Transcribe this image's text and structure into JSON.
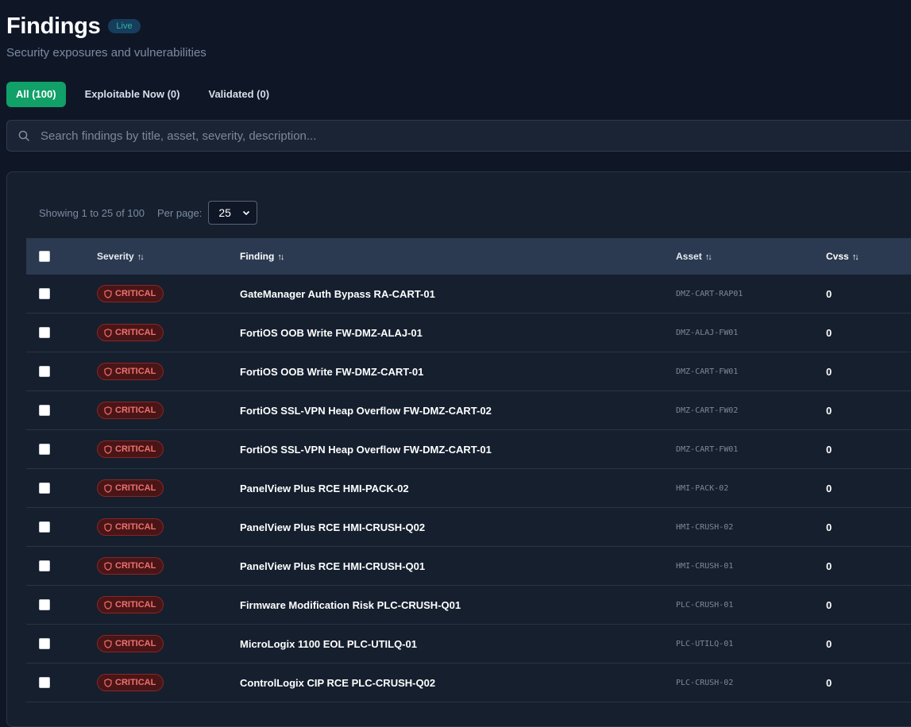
{
  "page": {
    "title": "Findings",
    "live_badge": "Live",
    "subtitle": "Security exposures and vulnerabilities"
  },
  "tabs": [
    {
      "label": "All (100)",
      "active": true
    },
    {
      "label": "Exploitable Now (0)",
      "active": false
    },
    {
      "label": "Validated (0)",
      "active": false
    }
  ],
  "search": {
    "placeholder": "Search findings by title, asset, severity, description...",
    "icon": "search-icon"
  },
  "pagination": {
    "showing": "Showing 1 to 25 of 100",
    "per_page_label": "Per page:",
    "per_page_value": "25"
  },
  "table": {
    "columns": {
      "severity": "Severity",
      "finding": "Finding",
      "asset": "Asset",
      "cvss": "Cvss"
    },
    "rows": [
      {
        "severity": "CRITICAL",
        "finding": "GateManager Auth Bypass RA-CART-01",
        "asset": "DMZ-CART-RAP01",
        "cvss": "0"
      },
      {
        "severity": "CRITICAL",
        "finding": "FortiOS OOB Write FW-DMZ-ALAJ-01",
        "asset": "DMZ-ALAJ-FW01",
        "cvss": "0"
      },
      {
        "severity": "CRITICAL",
        "finding": "FortiOS OOB Write FW-DMZ-CART-01",
        "asset": "DMZ-CART-FW01",
        "cvss": "0"
      },
      {
        "severity": "CRITICAL",
        "finding": "FortiOS SSL-VPN Heap Overflow FW-DMZ-CART-02",
        "asset": "DMZ-CART-FW02",
        "cvss": "0"
      },
      {
        "severity": "CRITICAL",
        "finding": "FortiOS SSL-VPN Heap Overflow FW-DMZ-CART-01",
        "asset": "DMZ-CART-FW01",
        "cvss": "0"
      },
      {
        "severity": "CRITICAL",
        "finding": "PanelView Plus RCE HMI-PACK-02",
        "asset": "HMI-PACK-02",
        "cvss": "0"
      },
      {
        "severity": "CRITICAL",
        "finding": "PanelView Plus RCE HMI-CRUSH-Q02",
        "asset": "HMI-CRUSH-02",
        "cvss": "0"
      },
      {
        "severity": "CRITICAL",
        "finding": "PanelView Plus RCE HMI-CRUSH-Q01",
        "asset": "HMI-CRUSH-01",
        "cvss": "0"
      },
      {
        "severity": "CRITICAL",
        "finding": "Firmware Modification Risk PLC-CRUSH-Q01",
        "asset": "PLC-CRUSH-01",
        "cvss": "0"
      },
      {
        "severity": "CRITICAL",
        "finding": "MicroLogix 1100 EOL PLC-UTILQ-01",
        "asset": "PLC-UTILQ-01",
        "cvss": "0"
      },
      {
        "severity": "CRITICAL",
        "finding": "ControlLogix CIP RCE PLC-CRUSH-Q02",
        "asset": "PLC-CRUSH-02",
        "cvss": "0"
      }
    ]
  },
  "colors": {
    "background": "#0f1727",
    "accent": "#11a067",
    "critical": "#f07070",
    "header_row": "#2b3a50"
  }
}
